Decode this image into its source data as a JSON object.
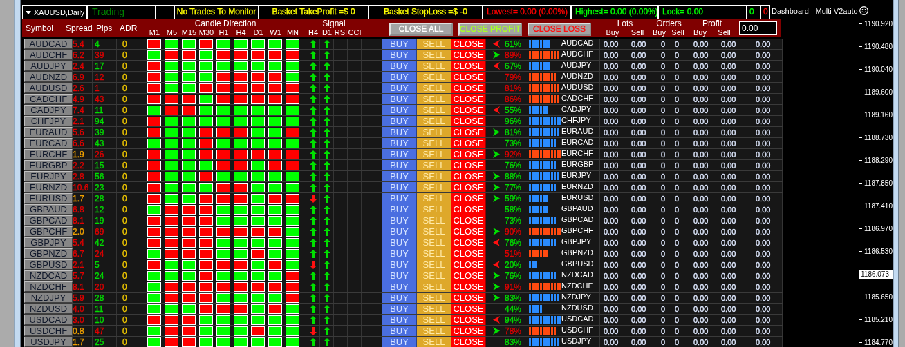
{
  "chart": {
    "title": "XAUUSD,Daily",
    "dashboard_label": "Dashboard - Multi V2auto"
  },
  "status": {
    "text": "Trading"
  },
  "info_boxes": [
    {
      "text": "No Trades To Monitor",
      "color": "#ffff00"
    },
    {
      "text": "Basket TakeProfit =$ 0",
      "color": "#ffff00"
    },
    {
      "text": "Basket StopLoss =$ -0",
      "color": "#ffff00"
    },
    {
      "text": "Lowest= 0.00 (0.00%)",
      "color": "#ff0000"
    },
    {
      "text": "Highest= 0.00 (0.00%)",
      "color": "#00ff00"
    },
    {
      "text": "Lock= 0.00",
      "color": "#00ff00"
    },
    {
      "text": "0",
      "color": "#00ff00"
    },
    {
      "text": "0",
      "color": "#ff0000"
    }
  ],
  "header": {
    "columns": [
      "Symbol",
      "Spread",
      "Pips",
      "ADR"
    ],
    "candle_title": "Candle Direction",
    "timeframes": [
      "M1",
      "M5",
      "M15",
      "M30",
      "H1",
      "H4",
      "D1",
      "W1",
      "MN"
    ],
    "signal_title": "Signal",
    "signal_columns": [
      "H4",
      "D1",
      "RSI",
      "CCI"
    ],
    "buttons": [
      {
        "label": "CLOSE ALL"
      },
      {
        "label": "CLOSE PROFIT"
      },
      {
        "label": "CLOSE LOSS"
      }
    ],
    "groups": [
      {
        "title": "Lots",
        "columns": [
          "Buy",
          "Sell"
        ]
      },
      {
        "title": "Orders",
        "columns": [
          "Buy",
          "Sell"
        ]
      },
      {
        "title": "Profit",
        "columns": [
          "Buy",
          "Sell"
        ]
      }
    ],
    "input": {
      "value": "0.00"
    }
  },
  "rows": [
    {
      "symbol": "AUDCAD",
      "spread": {
        "text": "5.4",
        "color": "#e00000"
      },
      "pips": {
        "text": "4",
        "color": "#00dd00"
      },
      "adr": "0",
      "candles_up": [
        false,
        true,
        true,
        false,
        true,
        true,
        true,
        true,
        true
      ],
      "signals_up": [
        true,
        true
      ],
      "actions": [
        "BUY",
        "SELL",
        "CLOSE"
      ],
      "trend_right": false,
      "strength": {
        "text": "61%",
        "bullish": true
      },
      "pair": "AUDCAD",
      "values": [
        "0.00",
        "0.00",
        "0",
        "0",
        "0.00",
        "0.00",
        "0.00"
      ]
    },
    {
      "symbol": "AUDCHF",
      "spread": {
        "text": "6.2",
        "color": "#e00000"
      },
      "pips": {
        "text": "39",
        "color": "#e00000"
      },
      "adr": "0",
      "candles_up": [
        true,
        false,
        false,
        true,
        false,
        false,
        false,
        false,
        false
      ],
      "signals_up": [
        true,
        true
      ],
      "actions": [
        "BUY",
        "SELL",
        "CLOSE"
      ],
      "trend_right": true,
      "strength": {
        "text": "89%",
        "bullish": false
      },
      "pair": "AUDCHF",
      "values": [
        "0.00",
        "0.00",
        "0",
        "0",
        "0.00",
        "0.00",
        "0.00"
      ]
    },
    {
      "symbol": "AUDJPY",
      "spread": {
        "text": "2.4",
        "color": "#e00000"
      },
      "pips": {
        "text": "17",
        "color": "#00dd00"
      },
      "adr": "0",
      "candles_up": [
        false,
        true,
        true,
        true,
        true,
        true,
        true,
        true,
        true
      ],
      "signals_up": [
        true,
        true
      ],
      "actions": [
        "BUY",
        "SELL",
        "CLOSE"
      ],
      "trend_right": false,
      "strength": {
        "text": "67%",
        "bullish": true
      },
      "pair": "AUDJPY",
      "values": [
        "0.00",
        "0.00",
        "0",
        "0",
        "0.00",
        "0.00",
        "0.00"
      ]
    },
    {
      "symbol": "AUDNZD",
      "spread": {
        "text": "6.9",
        "color": "#e00000"
      },
      "pips": {
        "text": "12",
        "color": "#e00000"
      },
      "adr": "0",
      "candles_up": [
        false,
        true,
        true,
        true,
        false,
        false,
        false,
        false,
        true
      ],
      "signals_up": [
        true,
        true
      ],
      "actions": [
        "BUY",
        "SELL",
        "CLOSE"
      ],
      "strength": {
        "text": "79%",
        "bullish": false
      },
      "pair": "AUDNZD",
      "values": [
        "0.00",
        "0.00",
        "0",
        "0",
        "0.00",
        "0.00",
        "0.00"
      ]
    },
    {
      "symbol": "AUDUSD",
      "spread": {
        "text": "2.6",
        "color": "#e00000"
      },
      "pips": {
        "text": "1",
        "color": "#e00000"
      },
      "adr": "0",
      "candles_up": [
        false,
        true,
        true,
        false,
        false,
        false,
        false,
        false,
        false
      ],
      "signals_up": [
        true,
        true
      ],
      "actions": [
        "BUY",
        "SELL",
        "CLOSE"
      ],
      "strength": {
        "text": "81%",
        "bullish": false
      },
      "pair": "AUDUSD",
      "values": [
        "0.00",
        "0.00",
        "0",
        "0",
        "0.00",
        "0.00",
        "0.00"
      ]
    },
    {
      "symbol": "CADCHF",
      "spread": {
        "text": "4.9",
        "color": "#e00000"
      },
      "pips": {
        "text": "43",
        "color": "#e00000"
      },
      "adr": "0",
      "candles_up": [
        false,
        false,
        false,
        true,
        false,
        false,
        false,
        false,
        false
      ],
      "signals_up": [
        true,
        true
      ],
      "actions": [
        "BUY",
        "SELL",
        "CLOSE"
      ],
      "strength": {
        "text": "86%",
        "bullish": false
      },
      "pair": "CADCHF",
      "values": [
        "0.00",
        "0.00",
        "0",
        "0",
        "0.00",
        "0.00",
        "0.00"
      ]
    },
    {
      "symbol": "CADJPY",
      "spread": {
        "text": "7.4",
        "color": "#e00000"
      },
      "pips": {
        "text": "11",
        "color": "#00dd00"
      },
      "adr": "0",
      "candles_up": [
        true,
        false,
        false,
        true,
        true,
        true,
        true,
        true,
        true
      ],
      "signals_up": [
        true,
        true
      ],
      "actions": [
        "BUY",
        "SELL",
        "CLOSE"
      ],
      "trend_right": false,
      "strength": {
        "text": "55%",
        "bullish": true
      },
      "pair": "CADJPY",
      "values": [
        "0.00",
        "0.00",
        "0",
        "0",
        "0.00",
        "0.00",
        "0.00"
      ]
    },
    {
      "symbol": "CHFJPY",
      "spread": {
        "text": "2.1",
        "color": "#e00000"
      },
      "pips": {
        "text": "94",
        "color": "#00dd00"
      },
      "adr": "0",
      "candles_up": [
        false,
        true,
        true,
        true,
        true,
        true,
        true,
        true,
        true
      ],
      "signals_up": [
        true,
        true
      ],
      "actions": [
        "BUY",
        "SELL",
        "CLOSE"
      ],
      "strength": {
        "text": "96%",
        "bullish": true
      },
      "pair": "CHFJPY",
      "values": [
        "0.00",
        "0.00",
        "0",
        "0",
        "0.00",
        "0.00",
        "0.00"
      ]
    },
    {
      "symbol": "EURAUD",
      "spread": {
        "text": "5.6",
        "color": "#e00000"
      },
      "pips": {
        "text": "39",
        "color": "#00dd00"
      },
      "adr": "0",
      "candles_up": [
        false,
        true,
        true,
        false,
        false,
        false,
        true,
        true,
        false
      ],
      "signals_up": [
        true,
        true
      ],
      "actions": [
        "BUY",
        "SELL",
        "CLOSE"
      ],
      "trend_right": true,
      "strength": {
        "text": "81%",
        "bullish": true
      },
      "pair": "EURAUD",
      "values": [
        "0.00",
        "0.00",
        "0",
        "0",
        "0.00",
        "0.00",
        "0.00"
      ]
    },
    {
      "symbol": "EURCAD",
      "spread": {
        "text": "6.6",
        "color": "#e00000"
      },
      "pips": {
        "text": "43",
        "color": "#00dd00"
      },
      "adr": "0",
      "candles_up": [
        true,
        true,
        true,
        false,
        true,
        true,
        true,
        true,
        true
      ],
      "signals_up": [
        true,
        true
      ],
      "actions": [
        "BUY",
        "SELL",
        "CLOSE"
      ],
      "strength": {
        "text": "73%",
        "bullish": true
      },
      "pair": "EURCAD",
      "values": [
        "0.00",
        "0.00",
        "0",
        "0",
        "0.00",
        "0.00",
        "0.00"
      ]
    },
    {
      "symbol": "EURCHF",
      "spread": {
        "text": "1.9",
        "color": "#f0a000"
      },
      "pips": {
        "text": "26",
        "color": "#e00000"
      },
      "adr": "0",
      "candles_up": [
        false,
        true,
        true,
        false,
        false,
        false,
        false,
        false,
        false
      ],
      "signals_up": [
        true,
        true
      ],
      "actions": [
        "BUY",
        "SELL",
        "CLOSE"
      ],
      "trend_right": true,
      "strength": {
        "text": "92%",
        "bullish": false
      },
      "pair": "EURCHF",
      "values": [
        "0.00",
        "0.00",
        "0",
        "0",
        "0.00",
        "0.00",
        "0.00"
      ]
    },
    {
      "symbol": "EURGBP",
      "spread": {
        "text": "2.2",
        "color": "#e00000"
      },
      "pips": {
        "text": "15",
        "color": "#00dd00"
      },
      "adr": "0",
      "candles_up": [
        false,
        true,
        true,
        true,
        false,
        false,
        true,
        false,
        false
      ],
      "signals_up": [
        true,
        true
      ],
      "actions": [
        "BUY",
        "SELL",
        "CLOSE"
      ],
      "strength": {
        "text": "76%",
        "bullish": true
      },
      "pair": "EURGBP",
      "values": [
        "0.00",
        "0.00",
        "0",
        "0",
        "0.00",
        "0.00",
        "0.00"
      ]
    },
    {
      "symbol": "EURJPY",
      "spread": {
        "text": "2.8",
        "color": "#e00000"
      },
      "pips": {
        "text": "56",
        "color": "#00dd00"
      },
      "adr": "0",
      "candles_up": [
        false,
        true,
        true,
        false,
        true,
        true,
        true,
        true,
        true
      ],
      "signals_up": [
        true,
        true
      ],
      "actions": [
        "BUY",
        "SELL",
        "CLOSE"
      ],
      "trend_right": true,
      "strength": {
        "text": "88%",
        "bullish": true
      },
      "pair": "EURJPY",
      "values": [
        "0.00",
        "0.00",
        "0",
        "0",
        "0.00",
        "0.00",
        "0.00"
      ]
    },
    {
      "symbol": "EURNZD",
      "spread": {
        "text": "10.6",
        "color": "#e00000"
      },
      "pips": {
        "text": "23",
        "color": "#00dd00"
      },
      "adr": "0",
      "candles_up": [
        false,
        true,
        true,
        true,
        false,
        false,
        true,
        true,
        true
      ],
      "signals_up": [
        true,
        true
      ],
      "actions": [
        "BUY",
        "SELL",
        "CLOSE"
      ],
      "trend_right": true,
      "strength": {
        "text": "77%",
        "bullish": true
      },
      "pair": "EURNZD",
      "values": [
        "0.00",
        "0.00",
        "0",
        "0",
        "0.00",
        "0.00",
        "0.00"
      ]
    },
    {
      "symbol": "EURUSD",
      "spread": {
        "text": "1.7",
        "color": "#f0a000"
      },
      "pips": {
        "text": "28",
        "color": "#00dd00"
      },
      "adr": "0",
      "candles_up": [
        false,
        true,
        true,
        false,
        false,
        false,
        true,
        false,
        false
      ],
      "signals_up": [
        false,
        true
      ],
      "actions": [
        "BUY",
        "SELL",
        "CLOSE"
      ],
      "trend_right": true,
      "strength": {
        "text": "59%",
        "bullish": true
      },
      "pair": "EURUSD",
      "values": [
        "0.00",
        "0.00",
        "0",
        "0",
        "0.00",
        "0.00",
        "0.00"
      ]
    },
    {
      "symbol": "GBPAUD",
      "spread": {
        "text": "6.8",
        "color": "#e00000"
      },
      "pips": {
        "text": "12",
        "color": "#00dd00"
      },
      "adr": "0",
      "candles_up": [
        true,
        false,
        false,
        false,
        true,
        true,
        true,
        true,
        true
      ],
      "signals_up": [
        true,
        true
      ],
      "actions": [
        "BUY",
        "SELL",
        "CLOSE"
      ],
      "strength": {
        "text": "58%",
        "bullish": true
      },
      "pair": "GBPAUD",
      "values": [
        "0.00",
        "0.00",
        "0",
        "0",
        "0.00",
        "0.00",
        "0.00"
      ]
    },
    {
      "symbol": "GBPCAD",
      "spread": {
        "text": "8.1",
        "color": "#e00000"
      },
      "pips": {
        "text": "19",
        "color": "#00dd00"
      },
      "adr": "0",
      "candles_up": [
        false,
        false,
        false,
        false,
        true,
        true,
        true,
        true,
        true
      ],
      "signals_up": [
        true,
        true
      ],
      "actions": [
        "BUY",
        "SELL",
        "CLOSE"
      ],
      "strength": {
        "text": "73%",
        "bullish": true
      },
      "pair": "GBPCAD",
      "values": [
        "0.00",
        "0.00",
        "0",
        "0",
        "0.00",
        "0.00",
        "0.00"
      ]
    },
    {
      "symbol": "GBPCHF",
      "spread": {
        "text": "2.0",
        "color": "#f0a000"
      },
      "pips": {
        "text": "69",
        "color": "#e00000"
      },
      "adr": "0",
      "candles_up": [
        false,
        false,
        false,
        false,
        false,
        false,
        false,
        false,
        true
      ],
      "signals_up": [
        true,
        true
      ],
      "actions": [
        "BUY",
        "SELL",
        "CLOSE"
      ],
      "trend_right": true,
      "strength": {
        "text": "90%",
        "bullish": false
      },
      "pair": "GBPCHF",
      "values": [
        "0.00",
        "0.00",
        "0",
        "0",
        "0.00",
        "0.00",
        "0.00"
      ]
    },
    {
      "symbol": "GBPJPY",
      "spread": {
        "text": "5.4",
        "color": "#e00000"
      },
      "pips": {
        "text": "42",
        "color": "#00dd00"
      },
      "adr": "0",
      "candles_up": [
        false,
        false,
        false,
        false,
        true,
        true,
        true,
        true,
        true
      ],
      "signals_up": [
        true,
        true
      ],
      "actions": [
        "BUY",
        "SELL",
        "CLOSE"
      ],
      "trend_right": false,
      "strength": {
        "text": "76%",
        "bullish": true
      },
      "pair": "GBPJPY",
      "values": [
        "0.00",
        "0.00",
        "0",
        "0",
        "0.00",
        "0.00",
        "0.00"
      ]
    },
    {
      "symbol": "GBPNZD",
      "spread": {
        "text": "6.7",
        "color": "#e00000"
      },
      "pips": {
        "text": "24",
        "color": "#e00000"
      },
      "adr": "0",
      "candles_up": [
        true,
        false,
        false,
        false,
        true,
        true,
        false,
        true,
        true
      ],
      "signals_up": [
        true,
        true
      ],
      "actions": [
        "BUY",
        "SELL",
        "CLOSE"
      ],
      "strength": {
        "text": "51%",
        "bullish": false
      },
      "pair": "GBPNZD",
      "values": [
        "0.00",
        "0.00",
        "0",
        "0",
        "0.00",
        "0.00",
        "0.00"
      ]
    },
    {
      "symbol": "GBPUSD",
      "spread": {
        "text": "2.1",
        "color": "#e00000"
      },
      "pips": {
        "text": "5",
        "color": "#00dd00"
      },
      "adr": "0",
      "candles_up": [
        false,
        true,
        true,
        false,
        false,
        false,
        true,
        false,
        true
      ],
      "signals_up": [
        false,
        true
      ],
      "actions": [
        "BUY",
        "SELL",
        "CLOSE"
      ],
      "trend_right": false,
      "strength": {
        "text": "20%",
        "bullish": true
      },
      "pair": "GBPUSD",
      "values": [
        "0.00",
        "0.00",
        "0",
        "0",
        "0.00",
        "0.00",
        "0.00"
      ]
    },
    {
      "symbol": "NZDCAD",
      "spread": {
        "text": "5.7",
        "color": "#e00000"
      },
      "pips": {
        "text": "24",
        "color": "#00dd00"
      },
      "adr": "0",
      "candles_up": [
        true,
        true,
        true,
        false,
        true,
        true,
        true,
        true,
        false
      ],
      "signals_up": [
        true,
        true
      ],
      "actions": [
        "BUY",
        "SELL",
        "CLOSE"
      ],
      "trend_right": true,
      "strength": {
        "text": "76%",
        "bullish": true
      },
      "pair": "NZDCAD",
      "values": [
        "0.00",
        "0.00",
        "0",
        "0",
        "0.00",
        "0.00",
        "0.00"
      ]
    },
    {
      "symbol": "NZDCHF",
      "spread": {
        "text": "8.1",
        "color": "#e00000"
      },
      "pips": {
        "text": "20",
        "color": "#e00000"
      },
      "adr": "0",
      "candles_up": [
        true,
        false,
        false,
        false,
        false,
        false,
        false,
        false,
        false
      ],
      "signals_up": [
        true,
        true
      ],
      "actions": [
        "BUY",
        "SELL",
        "CLOSE"
      ],
      "trend_right": true,
      "strength": {
        "text": "91%",
        "bullish": false
      },
      "pair": "NZDCHF",
      "values": [
        "0.00",
        "0.00",
        "0",
        "0",
        "0.00",
        "0.00",
        "0.00"
      ]
    },
    {
      "symbol": "NZDJPY",
      "spread": {
        "text": "5.9",
        "color": "#e00000"
      },
      "pips": {
        "text": "28",
        "color": "#00dd00"
      },
      "adr": "0",
      "candles_up": [
        true,
        false,
        false,
        false,
        true,
        true,
        true,
        true,
        false
      ],
      "signals_up": [
        true,
        true
      ],
      "actions": [
        "BUY",
        "SELL",
        "CLOSE"
      ],
      "trend_right": true,
      "strength": {
        "text": "83%",
        "bullish": true
      },
      "pair": "NZDJPY",
      "values": [
        "0.00",
        "0.00",
        "0",
        "0",
        "0.00",
        "0.00",
        "0.00"
      ]
    },
    {
      "symbol": "NZDUSD",
      "spread": {
        "text": "4.0",
        "color": "#e00000"
      },
      "pips": {
        "text": "11",
        "color": "#00dd00"
      },
      "adr": "0",
      "candles_up": [
        true,
        true,
        true,
        false,
        false,
        false,
        true,
        false,
        true
      ],
      "signals_up": [
        true,
        true
      ],
      "actions": [
        "BUY",
        "SELL",
        "CLOSE"
      ],
      "strength": {
        "text": "44%",
        "bullish": true
      },
      "pair": "NZDUSD",
      "values": [
        "0.00",
        "0.00",
        "0",
        "0",
        "0.00",
        "0.00",
        "0.00"
      ]
    },
    {
      "symbol": "USDCAD",
      "spread": {
        "text": "3.0",
        "color": "#e00000"
      },
      "pips": {
        "text": "10",
        "color": "#00dd00"
      },
      "adr": "0",
      "candles_up": [
        false,
        false,
        false,
        true,
        true,
        true,
        true,
        true,
        true
      ],
      "signals_up": [
        true,
        true
      ],
      "actions": [
        "BUY",
        "SELL",
        "CLOSE"
      ],
      "trend_right": false,
      "strength": {
        "text": "94%",
        "bullish": true
      },
      "pair": "USDCAD",
      "values": [
        "0.00",
        "0.00",
        "0",
        "0",
        "0.00",
        "0.00",
        "0.00"
      ]
    },
    {
      "symbol": "USDCHF",
      "spread": {
        "text": "0.8",
        "color": "#f0a000"
      },
      "pips": {
        "text": "47",
        "color": "#e00000"
      },
      "adr": "0",
      "candles_up": [
        true,
        false,
        false,
        true,
        true,
        true,
        false,
        true,
        true
      ],
      "signals_up": [
        false,
        true
      ],
      "actions": [
        "BUY",
        "SELL",
        "CLOSE"
      ],
      "trend_right": true,
      "strength": {
        "text": "78%",
        "bullish": false
      },
      "pair": "USDCHF",
      "values": [
        "0.00",
        "0.00",
        "0",
        "0",
        "0.00",
        "0.00",
        "0.00"
      ]
    },
    {
      "symbol": "USDJPY",
      "spread": {
        "text": "1.7",
        "color": "#f0a000"
      },
      "pips": {
        "text": "25",
        "color": "#00dd00"
      },
      "adr": "0",
      "candles_up": [
        true,
        false,
        false,
        true,
        true,
        true,
        true,
        true,
        true
      ],
      "signals_up": [
        true,
        true
      ],
      "actions": [
        "BUY",
        "SELL",
        "CLOSE"
      ],
      "strength": {
        "text": "83%",
        "bullish": true
      },
      "pair": "USDJPY",
      "values": [
        "0.00",
        "0.00",
        "0",
        "0",
        "0.00",
        "0.00",
        "0.00"
      ]
    }
  ],
  "price_axis": [
    {
      "text": "1190.920",
      "current": false
    },
    {
      "text": "1190.480",
      "current": false
    },
    {
      "text": "1190.040",
      "current": false
    },
    {
      "text": "1189.600",
      "current": false
    },
    {
      "text": "1189.160",
      "current": false
    },
    {
      "text": "1188.730",
      "current": false
    },
    {
      "text": "1188.290",
      "current": false
    },
    {
      "text": "1187.850",
      "current": false
    },
    {
      "text": "1187.410",
      "current": false
    },
    {
      "text": "1186.970",
      "current": false
    },
    {
      "text": "1186.530",
      "current": false
    },
    {
      "text": "1186.073",
      "current": true
    },
    {
      "text": "1185.650",
      "current": false
    },
    {
      "text": "1185.210",
      "current": false
    },
    {
      "text": "1184.770",
      "current": false
    }
  ]
}
